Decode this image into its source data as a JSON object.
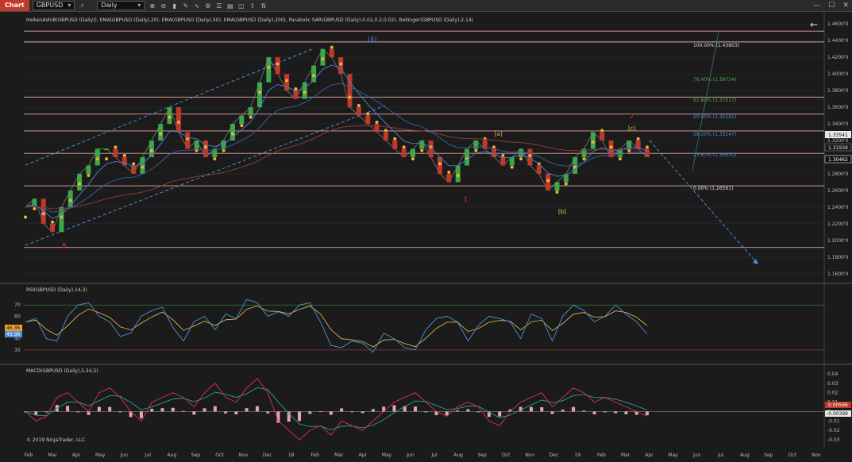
{
  "toolbar": {
    "tab_label": "Chart",
    "instrument": "GBPUSD",
    "timeframe": "Daily",
    "icons": [
      "search-icon",
      "zoom-in-icon",
      "zoom-out-icon",
      "bar-style-icon",
      "drawing-tool-icon",
      "indicator-icon",
      "strategy-icon",
      "properties-icon",
      "data-box-icon",
      "screenshot-icon",
      "share-icon",
      "chart-trader-icon"
    ],
    "window_buttons": [
      "minimize-icon",
      "maximize-icon",
      "close-icon"
    ]
  },
  "price_panel": {
    "indicator_label": "HeikenAshi8(GBPUSD (Daily)), EMA(GBPUSD (Daily),20), EMA(GBPUSD (Daily),50), EMA(GBPUSD (Daily),200), Parabolic SAR(GBPUSD (Daily),0.02,0.2,0.02), Bollinger(GBPUSD (Daily),2,14)",
    "back_arrow": "←",
    "y_ticks": [
      "1.4600'0",
      "1.4400'0",
      "1.4200'0",
      "1.4000'0",
      "1.3800'0",
      "1.3600'0",
      "1.3400'0",
      "1.3200'0",
      "1.3000'0",
      "1.2800'0",
      "1.2600'0",
      "1.2400'0",
      "1.2200'0",
      "1.2000'0",
      "1.1800'0",
      "1.1600'0"
    ],
    "price_badges": [
      {
        "text": "1.33541",
        "color": "#e8e8e8",
        "value": 1.3354
      },
      {
        "text": "1.31938",
        "color": "#1b1b1b",
        "value": 1.3194
      },
      {
        "text": "1.30462",
        "color": "#111111",
        "value": 1.3046
      }
    ],
    "wave_labels": [
      {
        "text": "(4)",
        "color": "#4a90d9"
      },
      {
        "text": "B",
        "color": "#e03030"
      },
      {
        "text": "1",
        "color": "#e03030"
      },
      {
        "text": "2",
        "color": "#e03030"
      },
      {
        "text": "[a]",
        "color": "#f0d040"
      },
      {
        "text": "[b]",
        "color": "#f0d040"
      },
      {
        "text": "[c]",
        "color": "#f0d040"
      }
    ],
    "fib_levels": [
      {
        "text": "100.00% (1.43803)",
        "color": "#dddddd"
      },
      {
        "text": "76.40% (1.39734)",
        "color": "#4caf50"
      },
      {
        "text": "61.80% (1.37217)",
        "color": "#4caf50"
      },
      {
        "text": "50.00% (1.35182)",
        "color": "#4a90d9"
      },
      {
        "text": "38.20% (1.33147)",
        "color": "#4a90d9"
      },
      {
        "text": "23.60% (1.30630)",
        "color": "#4a90d9"
      },
      {
        "text": "0.00% (1.26561)",
        "color": "#dddddd"
      }
    ],
    "copyright": "© 2019 NinjaTrader, LLC"
  },
  "rsi_panel": {
    "indicator_label": "RSI(GBPUSD (Daily),14,3)",
    "y_ticks": [
      "70",
      "60",
      "50",
      "40",
      "30"
    ],
    "badges": [
      {
        "text": "46.36",
        "color": "#f0a030"
      },
      {
        "text": "43.36",
        "color": "#4a90d9"
      }
    ]
  },
  "macd_panel": {
    "indicator_label": "MACD(GBPUSD (Daily),5,34,5)",
    "y_ticks": [
      "0.04",
      "0.03",
      "0.02",
      "0.01",
      "0",
      "-0.01",
      "-0.02",
      "-0.03"
    ],
    "badges": [
      {
        "text": "0.00596",
        "color": "#c0392b"
      },
      {
        "text": "-0.00399",
        "color": "#e8e8e8"
      }
    ]
  },
  "x_axis": {
    "labels": [
      "Feb",
      "Mar",
      "Apr",
      "May",
      "Jun",
      "Jul",
      "Aug",
      "Sep",
      "Oct",
      "Nov",
      "Dec",
      "18",
      "Feb",
      "Mar",
      "Apr",
      "May",
      "Jun",
      "Jul",
      "Aug",
      "Sep",
      "Oct",
      "Nov",
      "Dec",
      "19",
      "Feb",
      "Mar",
      "Apr",
      "May",
      "Jun",
      "Jul",
      "Aug",
      "Sep",
      "Oct",
      "Nov"
    ]
  },
  "chart_data": {
    "type": "line",
    "title": "",
    "xlabel": "",
    "ylabel": "",
    "instrument": "GBPUSD",
    "ylim": [
      1.155,
      1.465
    ],
    "horizontal_levels": [
      1.4515,
      1.4384,
      1.3722,
      1.3518,
      1.3315,
      1.3046,
      1.2656,
      1.1915
    ],
    "series": [
      {
        "name": "GBPUSD",
        "values": [
          1.24,
          1.25,
          1.22,
          1.21,
          1.24,
          1.26,
          1.28,
          1.29,
          1.31,
          1.31,
          1.3,
          1.29,
          1.28,
          1.3,
          1.32,
          1.34,
          1.36,
          1.33,
          1.31,
          1.32,
          1.3,
          1.31,
          1.32,
          1.34,
          1.35,
          1.36,
          1.39,
          1.42,
          1.4,
          1.38,
          1.37,
          1.39,
          1.41,
          1.43,
          1.42,
          1.4,
          1.36,
          1.35,
          1.34,
          1.33,
          1.32,
          1.31,
          1.3,
          1.31,
          1.32,
          1.3,
          1.28,
          1.27,
          1.29,
          1.31,
          1.32,
          1.31,
          1.3,
          1.29,
          1.3,
          1.31,
          1.29,
          1.28,
          1.26,
          1.27,
          1.28,
          1.3,
          1.31,
          1.33,
          1.32,
          1.3,
          1.31,
          1.32,
          1.31,
          1.3
        ]
      },
      {
        "name": "RSI",
        "values": [
          55,
          58,
          40,
          38,
          60,
          70,
          72,
          60,
          55,
          42,
          45,
          60,
          65,
          68,
          50,
          38,
          55,
          60,
          48,
          62,
          58,
          75,
          72,
          60,
          64,
          60,
          70,
          72,
          55,
          34,
          32,
          38,
          36,
          28,
          45,
          40,
          32,
          30,
          48,
          58,
          60,
          55,
          38,
          52,
          60,
          58,
          55,
          40,
          62,
          58,
          38,
          60,
          70,
          65,
          55,
          60,
          70,
          62,
          55,
          44
        ]
      },
      {
        "name": "MACD",
        "values": [
          0.0,
          -0.01,
          -0.005,
          0.015,
          0.02,
          0.01,
          0.0,
          0.02,
          0.025,
          0.015,
          0.0,
          -0.01,
          0.01,
          0.015,
          0.02,
          0.015,
          0.005,
          0.02,
          0.03,
          0.015,
          0.01,
          0.025,
          0.035,
          0.02,
          -0.01,
          -0.02,
          -0.03,
          -0.02,
          -0.015,
          -0.025,
          -0.01,
          -0.015,
          -0.02,
          -0.01,
          0.0,
          0.01,
          0.015,
          0.02,
          0.01,
          0.0,
          -0.005,
          0.005,
          0.01,
          0.005,
          -0.01,
          -0.015,
          0.0,
          0.01,
          0.015,
          0.02,
          0.005,
          0.015,
          0.025,
          0.02,
          0.01,
          0.015,
          0.01,
          0.005,
          0.0,
          -0.005
        ]
      }
    ]
  },
  "colors": {
    "background": "#1b1b1b",
    "grid": "#2e2e2e",
    "level_line": "#e8a5a5",
    "channel": "#4a90d9",
    "sar": "#f0b030",
    "rsi_line": "#4a90d9",
    "rsi_signal": "#f0c050",
    "macd_hist": "#e8a5a5",
    "macd_line": "#e03060",
    "macd_signal": "#2aa098"
  }
}
